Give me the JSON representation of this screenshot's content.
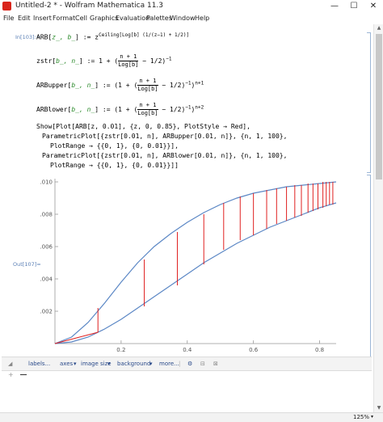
{
  "window": {
    "title": "Untitled-2 * - Wolfram Mathematica 11.3",
    "minimize": "—",
    "maximize": "☐",
    "close": "✕"
  },
  "menu": [
    "File",
    "Edit",
    "Insert",
    "Format",
    "Cell",
    "Graphics",
    "Evaluation",
    "Palettes",
    "Window",
    "Help"
  ],
  "cells": {
    "in_label": "In[103]:=",
    "out_label": "Out[107]=",
    "line1_lhs": "ARB[",
    "line1_args": "z_, b_",
    "line1_mid": "] := ",
    "line1_z": "z",
    "line1_exp": "Ceiling[Log[b] (1/(z−1) + 1/2)]",
    "line2_lhs": "zstr[",
    "line2_args": "b_, n_",
    "line2_rhs": "] := 1 + ",
    "line2_num": "n + 1",
    "line2_den": "Log[b]",
    "line2_tail": " − 1/2",
    "line2_pow": "−1",
    "line3_lhs": "ARBupper[",
    "line3_args": "b_, n_",
    "line3_rhs": "] := ",
    "line3_pow": "n+1",
    "line4_lhs": "ARBlower[",
    "line4_args": "b_, n_",
    "line4_rhs": "] := ",
    "line4_pow": "n+2",
    "show1": "Show[Plot[ARB[z, 0.01], {z, 0, 0.85}, PlotStyle → Red],",
    "show2": "ParametricPlot[{zstr[0.01, n], ARBupper[0.01, n]}, {n, 1, 100},",
    "show3": "PlotRange → {{0, 1}, {0, 0.01}}],",
    "show4": "ParametricPlot[{zstr[0.01, n], ARBlower[0.01, n]}, {n, 1, 100},",
    "show5": "PlotRange → {{0, 1}, {0, 0.01}}]]"
  },
  "toolbar": {
    "items": [
      "labels...",
      "axes",
      "image size",
      "background",
      "more..."
    ]
  },
  "status": {
    "zoom": "125%"
  },
  "colors": {
    "upper_lower_curves": "#5b87c5",
    "plot_series": "#e02020",
    "label_blue": "#5a7fb5"
  },
  "chart_data": {
    "type": "line",
    "xlim": [
      0,
      0.85
    ],
    "ylim": [
      0,
      0.0102
    ],
    "x_ticks": [
      "0.2",
      "0.4",
      "0.6",
      "0.8"
    ],
    "y_ticks": [
      "0.002",
      "0.004",
      "0.006",
      "0.008",
      "0.010"
    ],
    "series": [
      {
        "x": [
          0.0,
          0.05,
          0.1,
          0.15,
          0.2,
          0.25,
          0.3,
          0.35,
          0.4,
          0.45,
          0.5,
          0.55,
          0.6,
          0.65,
          0.7,
          0.75,
          0.8,
          0.85
        ],
        "y": [
          0.0,
          0.0004,
          0.0013,
          0.0025,
          0.0038,
          0.005,
          0.006,
          0.0068,
          0.0075,
          0.0081,
          0.0086,
          0.009,
          0.0093,
          0.0095,
          0.0097,
          0.0098,
          0.0099,
          0.01
        ]
      },
      {
        "x": [
          0.0,
          0.05,
          0.1,
          0.15,
          0.2,
          0.25,
          0.3,
          0.35,
          0.4,
          0.45,
          0.5,
          0.55,
          0.6,
          0.65,
          0.7,
          0.75,
          0.8,
          0.85
        ],
        "y": [
          0.0,
          0.0001,
          0.0004,
          0.0009,
          0.0015,
          0.0022,
          0.0029,
          0.0036,
          0.0043,
          0.005,
          0.0056,
          0.0062,
          0.0067,
          0.0072,
          0.0076,
          0.008,
          0.0084,
          0.0087
        ]
      },
      {
        "x": [
          0.13,
          0.27,
          0.37,
          0.45,
          0.51,
          0.56,
          0.6,
          0.64,
          0.67,
          0.7,
          0.725,
          0.745,
          0.765,
          0.78,
          0.795,
          0.81,
          0.82,
          0.83,
          0.84
        ],
        "y_upper": [
          0.0022,
          0.0052,
          0.0069,
          0.008,
          0.0087,
          0.0091,
          0.0093,
          0.0095,
          0.0096,
          0.0097,
          0.0098,
          0.0098,
          0.0099,
          0.0099,
          0.0099,
          0.01,
          0.01,
          0.01,
          0.01
        ],
        "y_lower": [
          0.0007,
          0.0023,
          0.0036,
          0.0049,
          0.0058,
          0.0064,
          0.0067,
          0.0071,
          0.0074,
          0.0076,
          0.0078,
          0.0079,
          0.0081,
          0.0082,
          0.0083,
          0.0084,
          0.0085,
          0.0086,
          0.0086
        ]
      }
    ]
  }
}
